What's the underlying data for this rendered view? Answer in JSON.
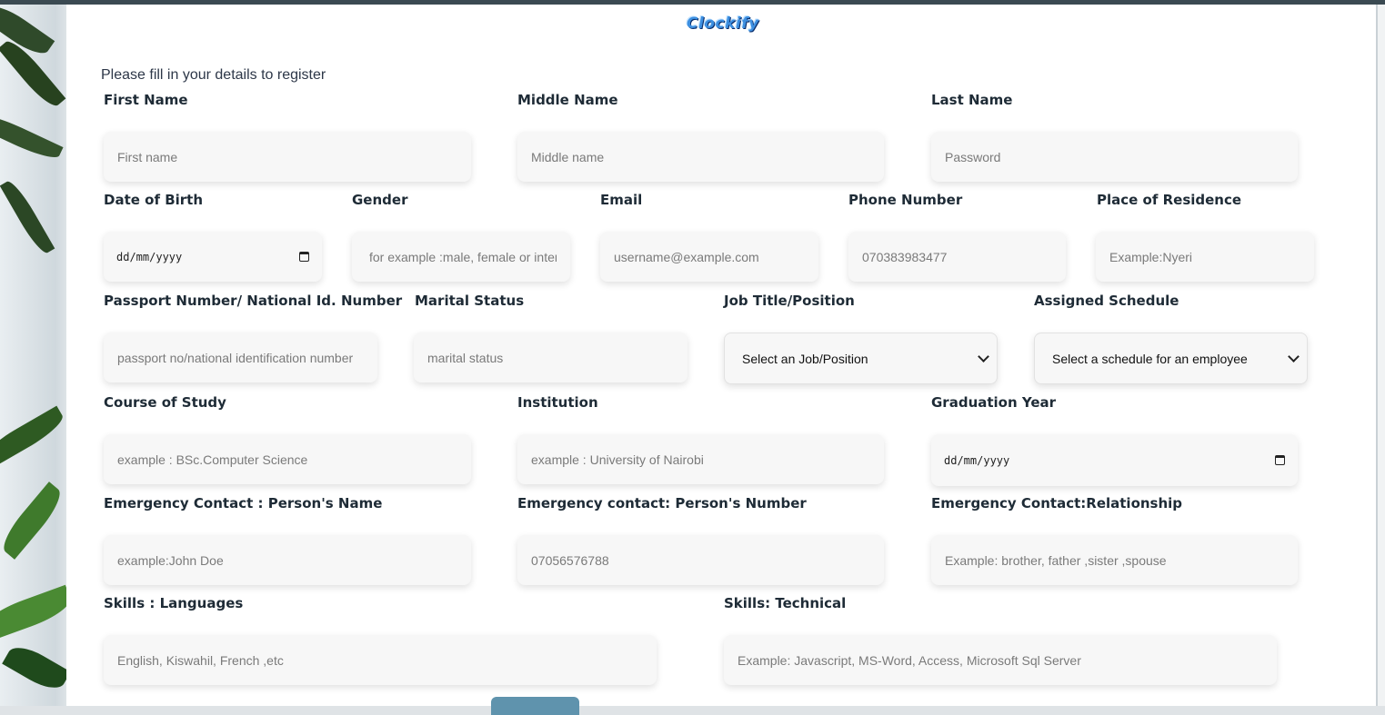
{
  "app": {
    "logo_text": "Clockify"
  },
  "form": {
    "intro": "Please fill in your details to register",
    "first_name": {
      "label": "First Name",
      "placeholder": "First name"
    },
    "middle_name": {
      "label": "Middle Name",
      "placeholder": "Middle name"
    },
    "last_name": {
      "label": "Last Name",
      "placeholder": "Password"
    },
    "dob": {
      "label": "Date of Birth",
      "value": "dd/mm/yyyy"
    },
    "gender": {
      "label": "Gender",
      "placeholder": "for example :male, female or intersex"
    },
    "email": {
      "label": "Email",
      "placeholder": "username@example.com"
    },
    "phone": {
      "label": "Phone Number",
      "placeholder": "070383983477"
    },
    "residence": {
      "label": "Place of Residence",
      "placeholder": "Example:Nyeri"
    },
    "passport": {
      "label": "Passport Number/ National Id. Number",
      "placeholder": "passport no/national identification number"
    },
    "marital": {
      "label": "Marital Status",
      "placeholder": "marital status"
    },
    "job": {
      "label": "Job Title/Position",
      "selected": "Select an Job/Position"
    },
    "schedule": {
      "label": "Assigned Schedule",
      "selected": "Select a schedule for an employee"
    },
    "course": {
      "label": "Course of Study",
      "placeholder": "example : BSc.Computer Science"
    },
    "institution": {
      "label": "Institution",
      "placeholder": "example : University of Nairobi"
    },
    "grad_year": {
      "label": "Graduation Year",
      "value": "dd/mm/yyyy"
    },
    "ec_name": {
      "label": "Emergency Contact : Person's Name",
      "placeholder": "example:John Doe"
    },
    "ec_number": {
      "label": "Emergency contact: Person's Number",
      "placeholder": "07056576788"
    },
    "ec_relationship": {
      "label": "Emergency Contact:Relationship",
      "placeholder": "Example: brother, father ,sister ,spouse"
    },
    "skills_languages": {
      "label": "Skills : Languages",
      "placeholder": "English, Kiswahil, French ,etc"
    },
    "skills_technical": {
      "label": "Skills: Technical",
      "placeholder": "Example: Javascript, MS-Word, Access, Microsoft Sql Server"
    }
  },
  "colors": {
    "submit_button": "#5f93ad",
    "field_bg": "#f7f7f7",
    "logo": "#3d8fe0"
  }
}
